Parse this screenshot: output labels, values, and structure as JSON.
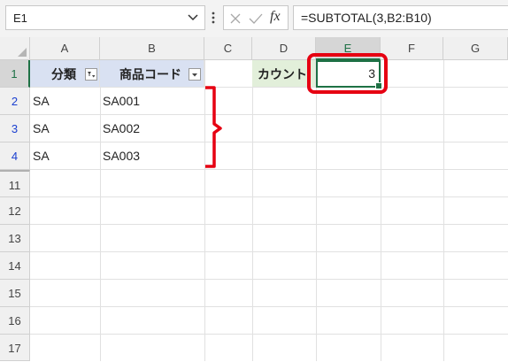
{
  "formula_bar": {
    "name_box": "E1",
    "formula": "=SUBTOTAL(3,B2:B10)",
    "cancel_icon": "close-icon",
    "enter_icon": "check-icon",
    "function_label": "fx"
  },
  "columns": [
    "A",
    "B",
    "C",
    "D",
    "E",
    "F",
    "G"
  ],
  "rows": [
    "1",
    "2",
    "3",
    "4",
    "11",
    "12",
    "13",
    "14",
    "15",
    "16",
    "17"
  ],
  "cells": {
    "A1": "分類",
    "B1": "商品コード",
    "D1": "カウント",
    "E1": "3",
    "A2": "SA",
    "B2": "SA001",
    "A3": "SA",
    "B3": "SA002",
    "A4": "SA",
    "B4": "SA003"
  },
  "colors": {
    "header_fill": "#d9e1f2",
    "count_label_fill": "#e2efda",
    "selection_border": "#1e7145",
    "annotation_red": "#e60012",
    "filtered_row_number": "#1a3fd0"
  }
}
